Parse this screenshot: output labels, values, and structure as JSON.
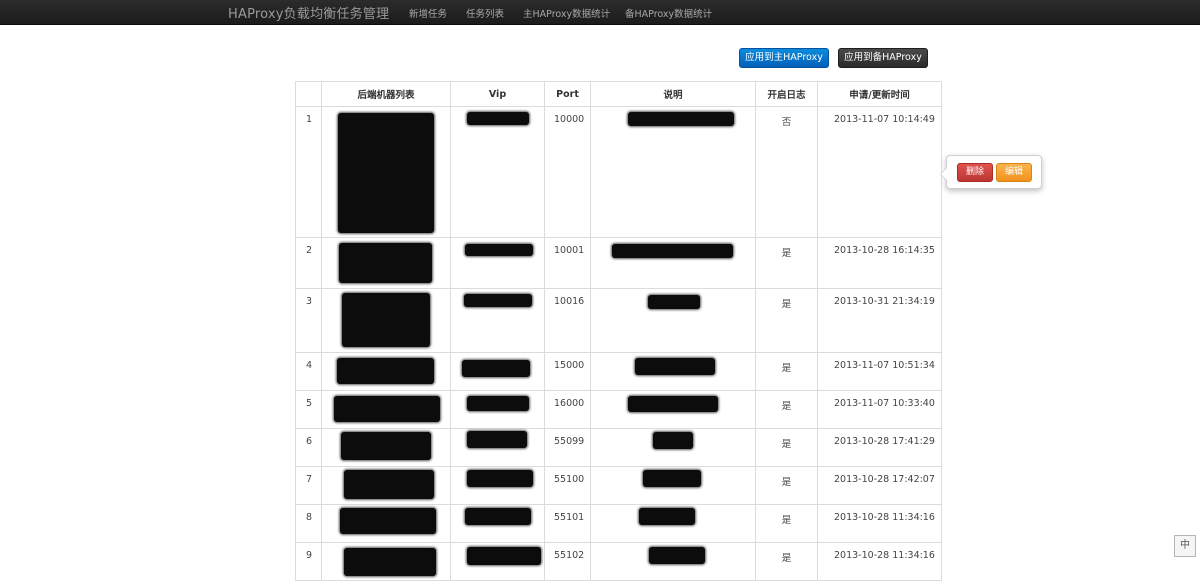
{
  "navbar": {
    "brand": "HAProxy负载均衡任务管理",
    "links": [
      "新增任务",
      "任务列表",
      "主HAProxy数据统计",
      "备HAProxy数据统计"
    ]
  },
  "toolbar": {
    "apply_main_label": "应用到主HAProxy",
    "apply_backup_label": "应用到备HAProxy"
  },
  "table": {
    "headers": [
      "",
      "后端机器列表",
      "Vip",
      "Port",
      "说明",
      "开启日志",
      "申请/更新时间"
    ],
    "rows": [
      {
        "num": "1",
        "port": "10000",
        "log": "否",
        "time": "2013-11-07 10:14:49"
      },
      {
        "num": "2",
        "port": "10001",
        "log": "是",
        "time": "2013-10-28 16:14:35"
      },
      {
        "num": "3",
        "port": "10016",
        "log": "是",
        "time": "2013-10-31 21:34:19"
      },
      {
        "num": "4",
        "port": "15000",
        "log": "是",
        "time": "2013-11-07 10:51:34"
      },
      {
        "num": "5",
        "port": "16000",
        "log": "是",
        "time": "2013-11-07 10:33:40"
      },
      {
        "num": "6",
        "port": "55099",
        "log": "是",
        "time": "2013-10-28 17:41:29"
      },
      {
        "num": "7",
        "port": "55100",
        "log": "是",
        "time": "2013-10-28 17:42:07"
      },
      {
        "num": "8",
        "port": "55101",
        "log": "是",
        "time": "2013-10-28 11:34:16"
      },
      {
        "num": "9",
        "port": "55102",
        "log": "是",
        "time": "2013-10-28 11:34:16"
      }
    ]
  },
  "popover": {
    "delete_label": "删除",
    "edit_label": "编辑"
  },
  "ime": {
    "label": "中"
  }
}
